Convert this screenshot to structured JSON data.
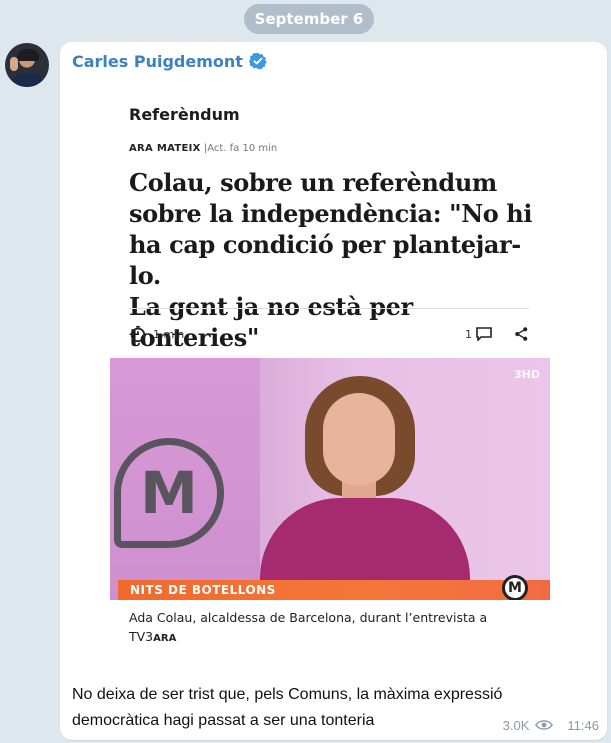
{
  "date_separator": "September 6",
  "message": {
    "sender": "Carles Puigdemont",
    "text": "No deixa de ser trist que, pels Comuns, la màxima expressió democràtica hagi passat a ser una tonteria",
    "views": "3.0K",
    "time": "11:46"
  },
  "article": {
    "section": "Referèndum",
    "outlet": "ARA MATEIX",
    "updated": "|Act. fa 10 min",
    "headline": "Colau, sobre un referèndum\nsobre la independència: \"No hi\nha cap condició per plantejar-lo.\nLa gent ja no està per tonteries\"",
    "read_time": "1 min",
    "comments": "1",
    "photo": {
      "channel_logo": "3HD",
      "logo_letter": "M",
      "banner": "NITS DE BOTELLONS",
      "badge": "M"
    },
    "caption": "Ada Colau, alcaldessa de Barcelona, durant l’entrevista a TV3",
    "caption_source": "ARA"
  },
  "colors": {
    "background": "#dfe7ee",
    "sender": "#3a82c4",
    "verified": "#3a9ae0",
    "meta": "#8a9aa8"
  }
}
